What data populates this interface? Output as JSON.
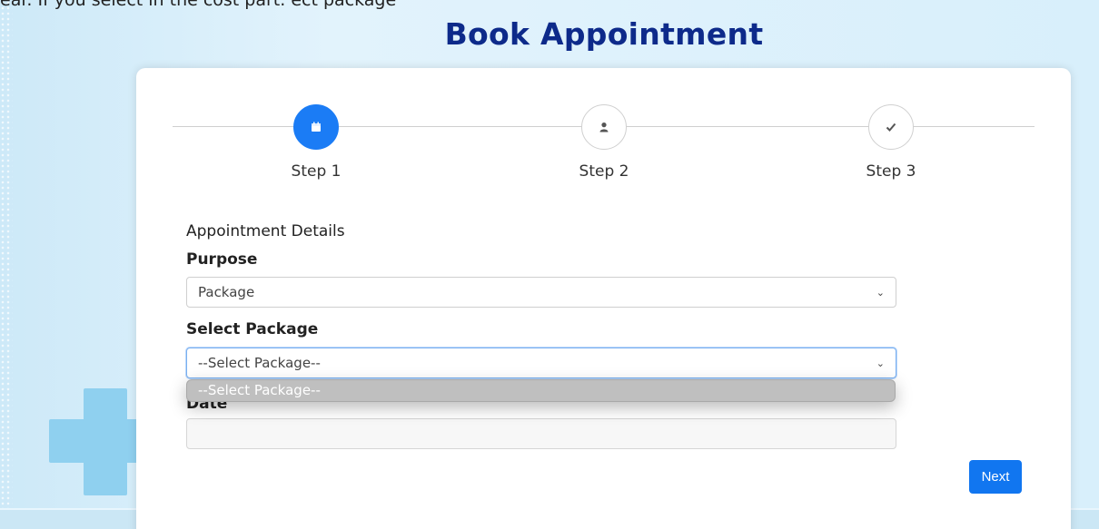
{
  "header": {
    "cut_text": "ear. If you select in the cost part. ect package",
    "title": "Book Appointment"
  },
  "steps": [
    {
      "label": "Step 1",
      "icon": "calendar-icon",
      "active": true
    },
    {
      "label": "Step 2",
      "icon": "user-icon",
      "active": false
    },
    {
      "label": "Step 3",
      "icon": "check-icon",
      "active": false
    }
  ],
  "form": {
    "section_title": "Appointment Details",
    "purpose_label": "Purpose",
    "purpose_value": "Package",
    "package_label": "Select Package",
    "package_value": "--Select Package--",
    "dropdown_options": [
      "--Select Package--"
    ],
    "date_label": "Date",
    "date_value": "",
    "next_label": "Next"
  },
  "colors": {
    "accent": "#1b7cf5",
    "title": "#0d2a8a",
    "background": "#d6eefa"
  }
}
